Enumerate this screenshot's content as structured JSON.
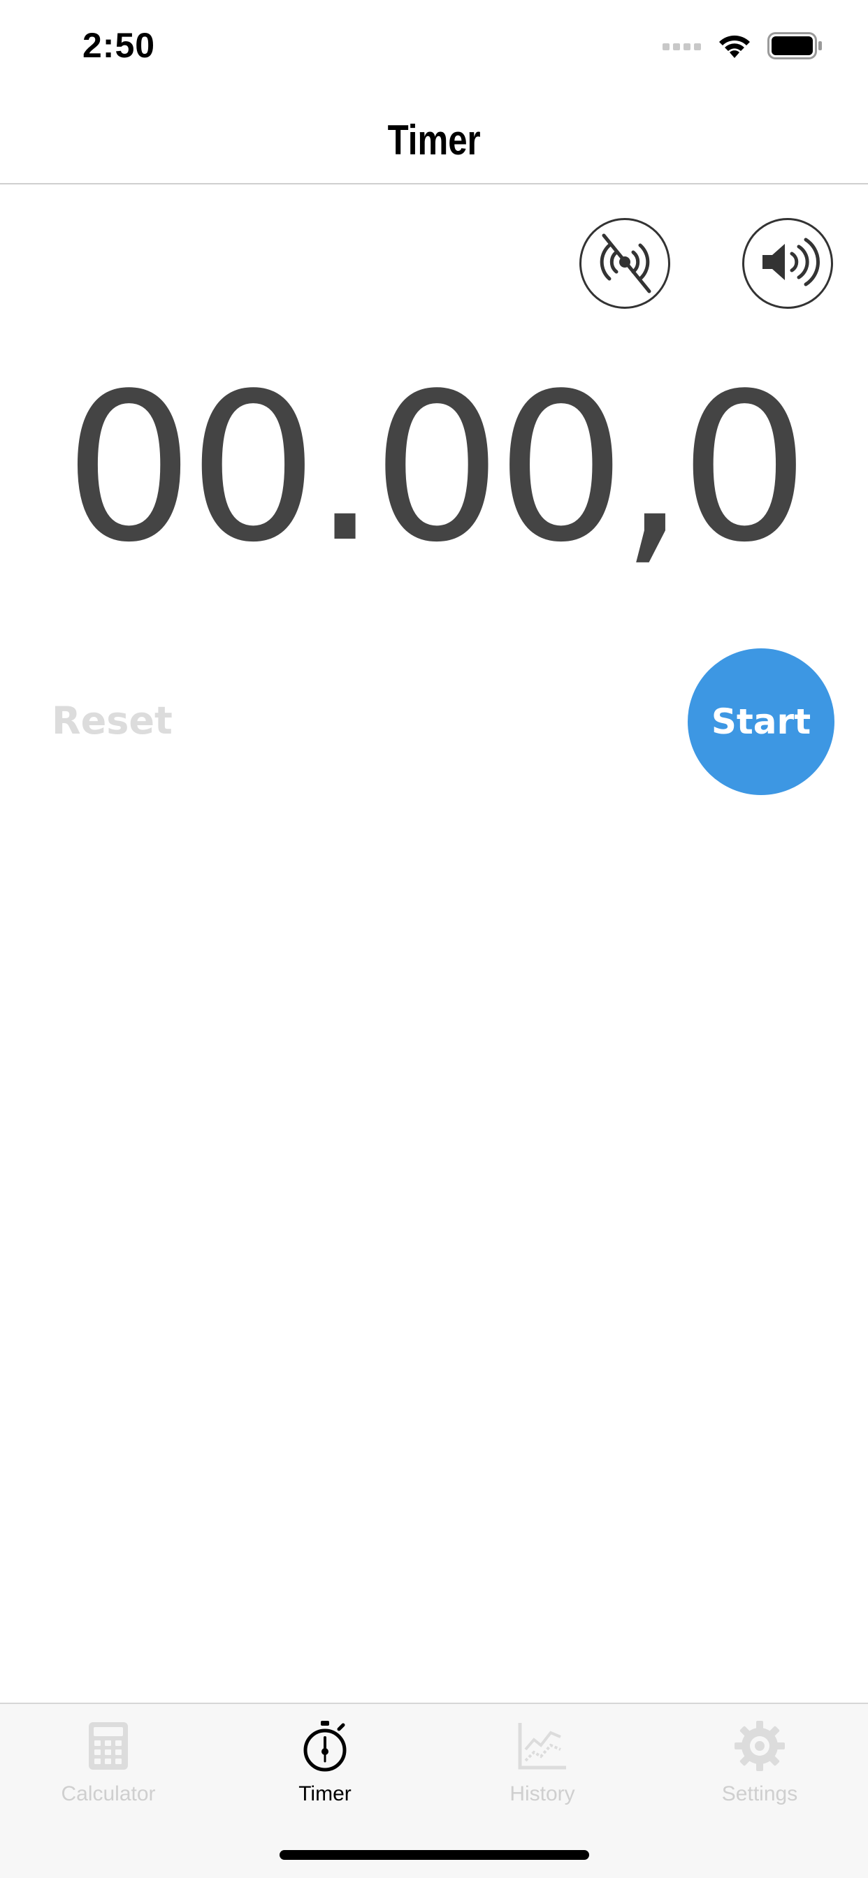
{
  "status_bar": {
    "time": "2:50",
    "icons": [
      "signal-icon",
      "wifi-icon",
      "battery-icon"
    ]
  },
  "nav": {
    "title": "Timer"
  },
  "controls": {
    "vibration_icon": "vibration-off-icon",
    "sound_icon": "sound-on-icon",
    "timer_value": "00.00,0",
    "reset_label": "Reset",
    "start_label": "Start"
  },
  "tabs": [
    {
      "label": "Calculator",
      "icon": "calculator-icon",
      "active": false
    },
    {
      "label": "Timer",
      "icon": "stopwatch-icon",
      "active": true
    },
    {
      "label": "History",
      "icon": "chart-icon",
      "active": false
    },
    {
      "label": "Settings",
      "icon": "gear-icon",
      "active": false
    }
  ],
  "colors": {
    "accent": "#3d97e3",
    "timer_text": "#444444",
    "inactive": "#cfcfcf",
    "tab_bar_bg": "#f7f7f7"
  }
}
